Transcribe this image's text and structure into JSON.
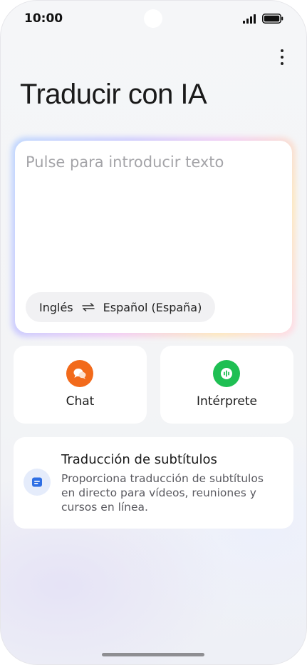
{
  "status_bar": {
    "time": "10:00"
  },
  "header": {
    "title": "Traducir con IA",
    "more_icon": "more-vertical-icon"
  },
  "input": {
    "placeholder": "Pulse para introducir texto",
    "source_lang": "Inglés",
    "target_lang": "Español (España)",
    "swap_icon": "swap-arrows-icon"
  },
  "features": [
    {
      "label": "Chat",
      "icon": "chat-bubbles-icon",
      "color": "#f26a1b"
    },
    {
      "label": "Intérprete",
      "icon": "interpreter-voice-icon",
      "color": "#1fbf53"
    }
  ],
  "subtitle_card": {
    "title": "Traducción de subtítulos",
    "description": "Proporciona traducción de subtítulos en directo para vídeos, reuniones y cursos en línea.",
    "icon": "subtitles-icon",
    "icon_color": "#2f6fe4"
  }
}
